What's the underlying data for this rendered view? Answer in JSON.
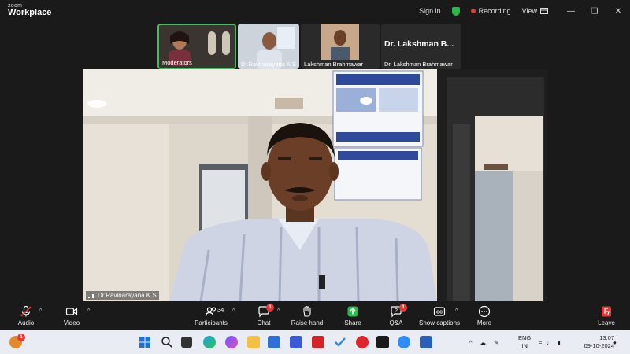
{
  "app": {
    "logo_small": "zoom",
    "logo_big": "Workplace"
  },
  "titlebar": {
    "sign_in": "Sign in",
    "recording": "Recording",
    "view": "View"
  },
  "participants_strip": [
    {
      "label": "Moderators",
      "active": true
    },
    {
      "label": "Dr.Ravinarayana K S",
      "active": false
    },
    {
      "label": "Lakshman Brahmawar",
      "active": false
    },
    {
      "label": "Dr. Lakshman Brahmawar",
      "big_name": "Dr. Lakshman B...",
      "active": false
    }
  ],
  "main_video": {
    "speaker_label": "Dr.Ravinarayana K S"
  },
  "toolbar": {
    "audio": "Audio",
    "video": "Video",
    "participants": "Participants",
    "participants_count": "34",
    "chat": "Chat",
    "chat_badge": "1",
    "raise_hand": "Raise hand",
    "share": "Share",
    "qa": "Q&A",
    "qa_badge": "1",
    "show_captions": "Show captions",
    "more": "More",
    "leave": "Leave"
  },
  "taskbar": {
    "weather_badge": "1",
    "lang_top": "ENG",
    "lang_bottom": "IN",
    "time": "13:07",
    "date": "09-10-2024"
  },
  "colors": {
    "accent_green": "#3fbf5f",
    "recording_red": "#e53935",
    "leave_red": "#e53935"
  }
}
